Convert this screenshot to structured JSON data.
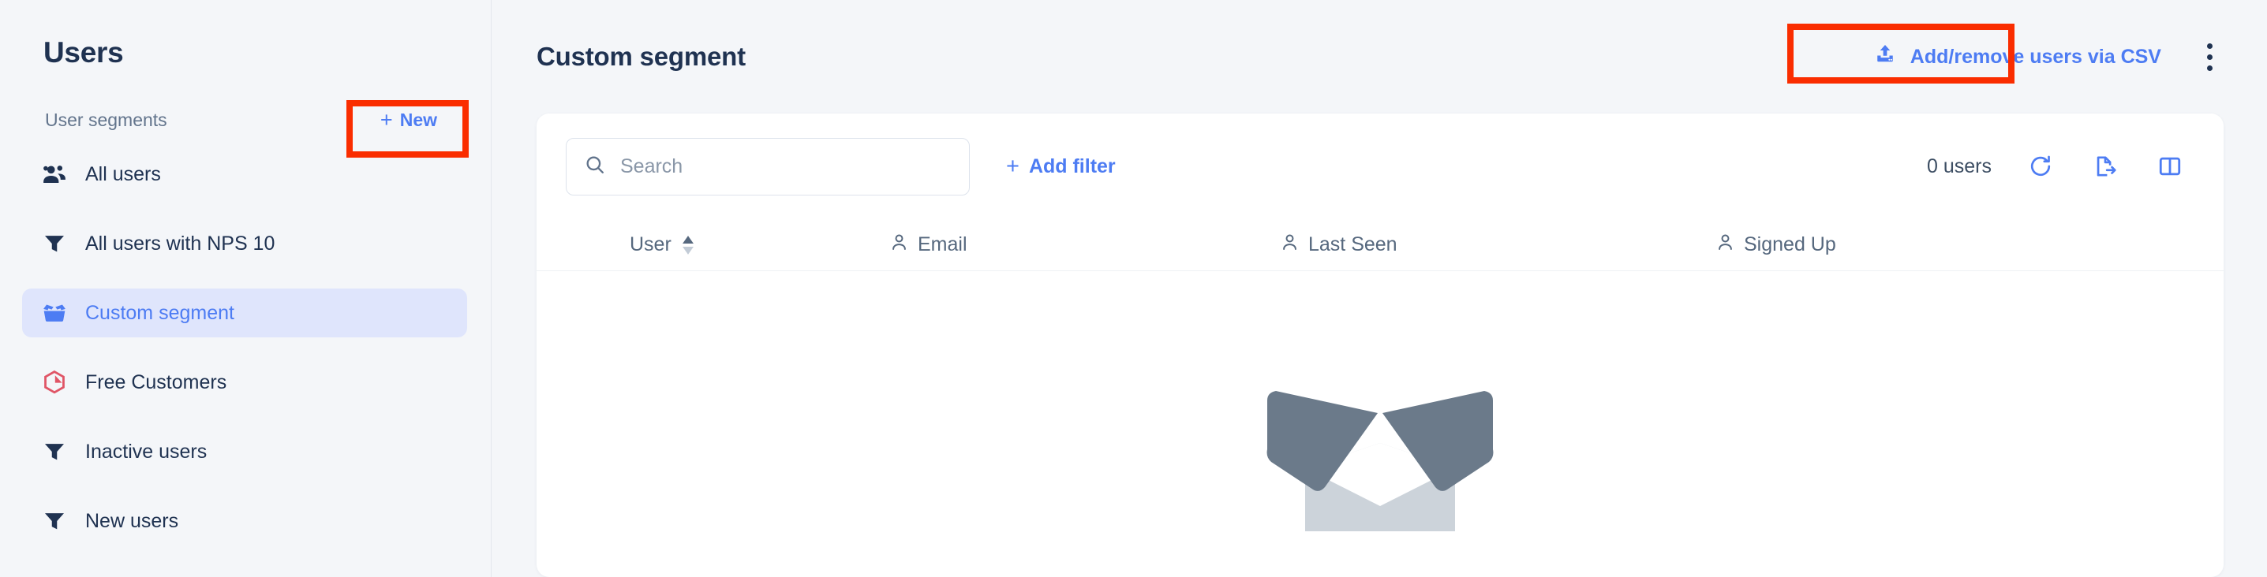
{
  "sidebar": {
    "title": "Users",
    "segments_label": "User segments",
    "new_button": {
      "label": "New",
      "plus": "+",
      "icon": "plus-icon"
    },
    "items": [
      {
        "label": "All users",
        "icon": "users-group-icon",
        "active": false
      },
      {
        "label": "All users with NPS 10",
        "icon": "funnel-icon",
        "active": false
      },
      {
        "label": "Custom segment",
        "icon": "open-box-icon",
        "active": true
      },
      {
        "label": "Free Customers",
        "icon": "hexagon-chart-icon",
        "active": false
      },
      {
        "label": "Inactive users",
        "icon": "funnel-icon",
        "active": false
      },
      {
        "label": "New users",
        "icon": "funnel-icon",
        "active": false
      }
    ]
  },
  "header": {
    "title": "Custom segment",
    "csv_button": {
      "label": "Add/remove users via CSV",
      "icon": "upload-icon"
    },
    "kebab_menu": "more-options-icon"
  },
  "toolbar": {
    "search": {
      "placeholder": "Search",
      "value": "",
      "icon": "search-icon"
    },
    "add_filter": {
      "label": "Add filter",
      "plus": "+"
    },
    "user_count": "0 users",
    "icons": [
      {
        "name": "refresh-icon",
        "label": "Refresh"
      },
      {
        "name": "export-icon",
        "label": "Export"
      },
      {
        "name": "columns-icon",
        "label": "Columns"
      }
    ]
  },
  "table": {
    "columns": [
      {
        "label": "User",
        "icon": "sort-icon",
        "sortable": true
      },
      {
        "label": "Email",
        "icon": "person-icon",
        "sortable": false
      },
      {
        "label": "Last Seen",
        "icon": "person-icon",
        "sortable": false
      },
      {
        "label": "Signed Up",
        "icon": "person-icon",
        "sortable": false
      }
    ],
    "rows": [],
    "empty_illustration": "empty-box-illustration"
  },
  "colors": {
    "accent_blue": "#4d7cf3",
    "text_navy": "#1f3251",
    "muted": "#62748c",
    "active_bg": "#dfe5fc",
    "annotation_red": "#fa2d00",
    "hexagon_red": "#e05566",
    "illus_dark": "#6b7a8a",
    "illus_light": "#ccd3da",
    "page_bg": "#f4f6f9"
  },
  "annotations": [
    {
      "name": "highlight-new-button",
      "target": "new-button"
    },
    {
      "name": "highlight-csv-button",
      "target": "csv-button"
    }
  ]
}
